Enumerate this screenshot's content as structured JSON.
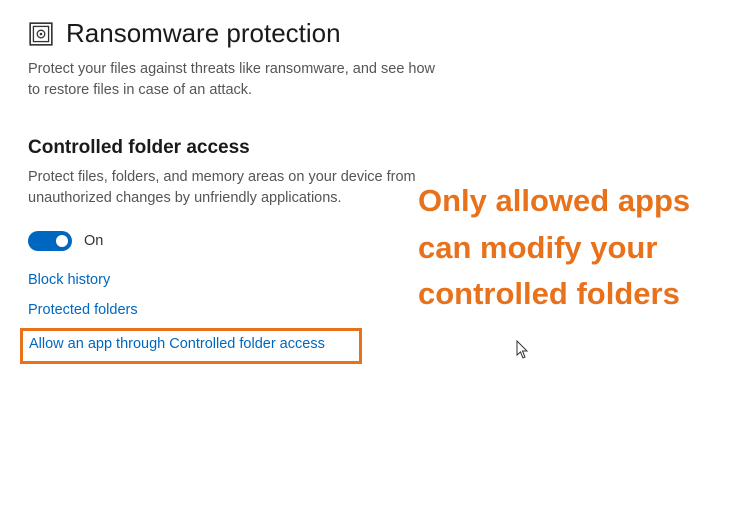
{
  "header": {
    "title": "Ransomware protection",
    "description": "Protect your files against threats like ransomware, and see how to restore files in case of an attack."
  },
  "section": {
    "title": "Controlled folder access",
    "description": "Protect files, folders, and memory areas on your device from unauthorized changes by unfriendly applications.",
    "toggle_state": "On"
  },
  "links": {
    "block_history": "Block history",
    "protected_folders": "Protected folders",
    "allow_app": "Allow an app through Controlled folder access"
  },
  "annotation": {
    "line1": "Only allowed apps",
    "line2": "can modify your controlled folders"
  },
  "colors": {
    "accent_blue": "#0067c0",
    "highlight_orange": "#e8711c"
  }
}
